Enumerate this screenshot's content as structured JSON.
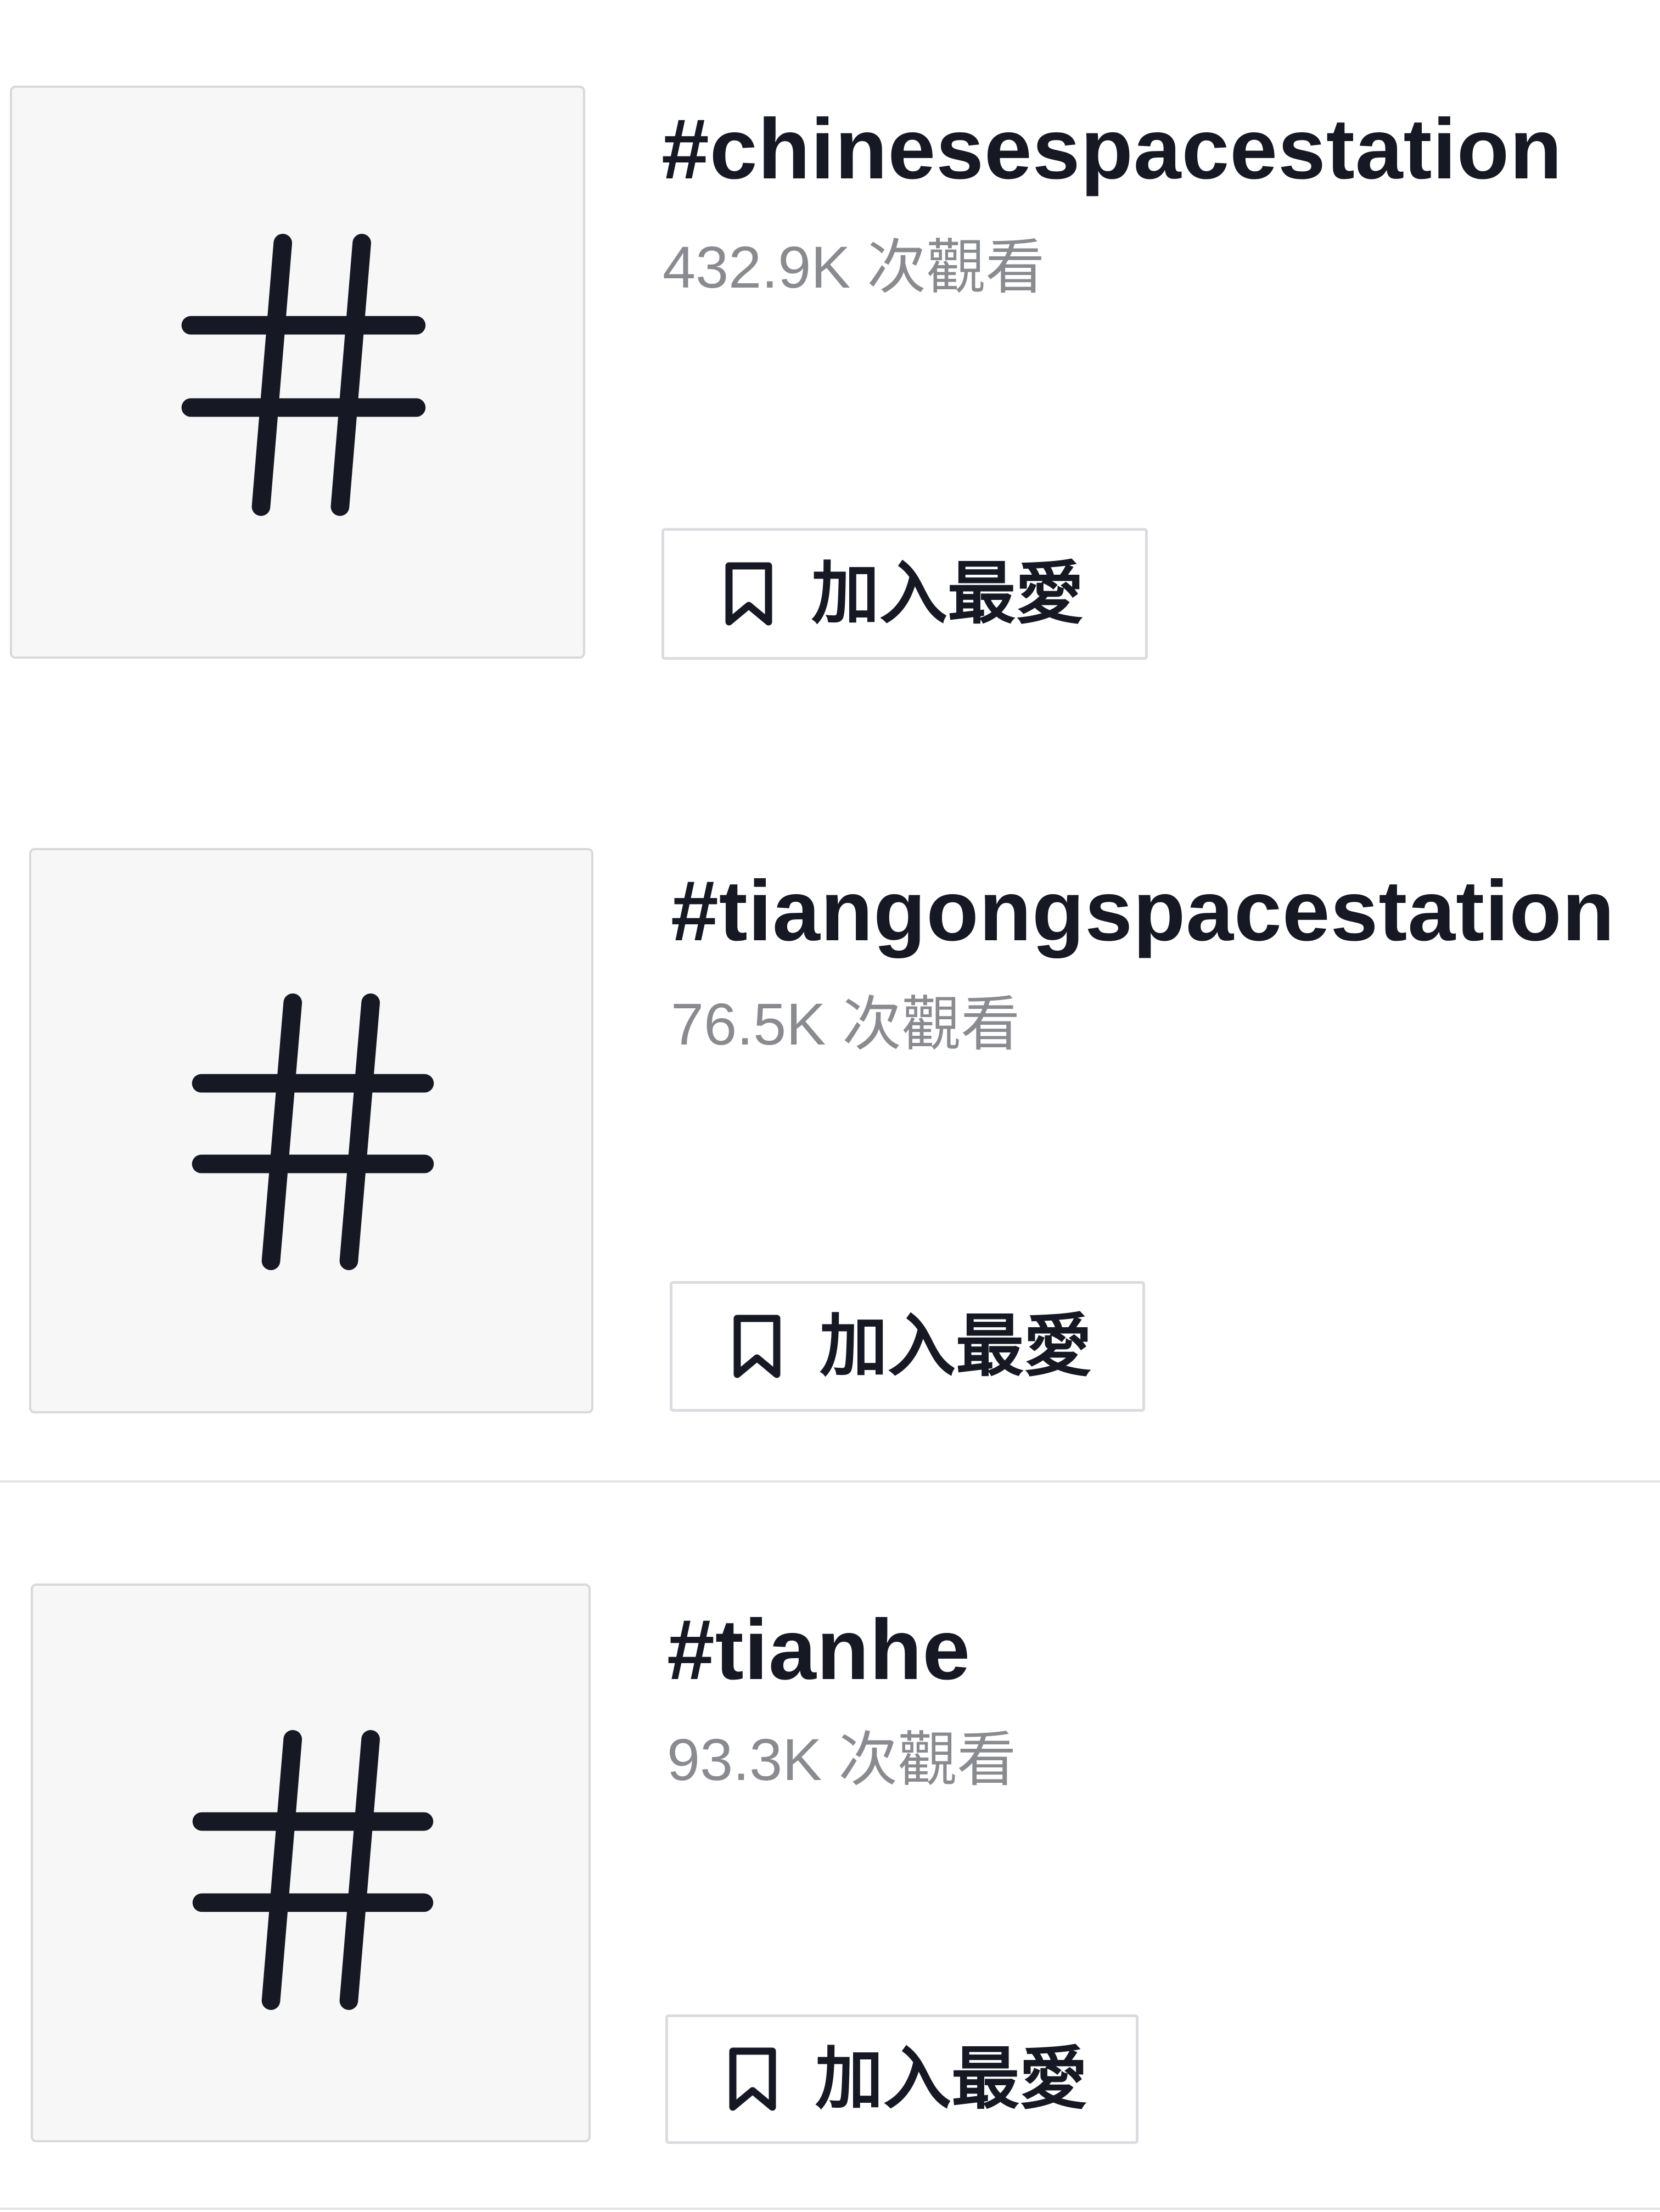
{
  "hashtags": [
    {
      "name": "#chinesespacestation",
      "views": "432.9K 次觀看",
      "favorite_label": "加入最愛"
    },
    {
      "name": "#tiangongspacestation",
      "views": "76.5K 次觀看",
      "favorite_label": "加入最愛"
    },
    {
      "name": "#tianhe",
      "views": "93.3K 次觀看",
      "favorite_label": "加入最愛"
    }
  ],
  "icons": {
    "thumbnail": "hashtag-icon",
    "favorite": "bookmark-icon"
  },
  "colors": {
    "text_primary": "#161823",
    "text_secondary": "#8a8b91",
    "thumbnail_bg": "#f7f7f7",
    "border": "#dcdce0"
  }
}
